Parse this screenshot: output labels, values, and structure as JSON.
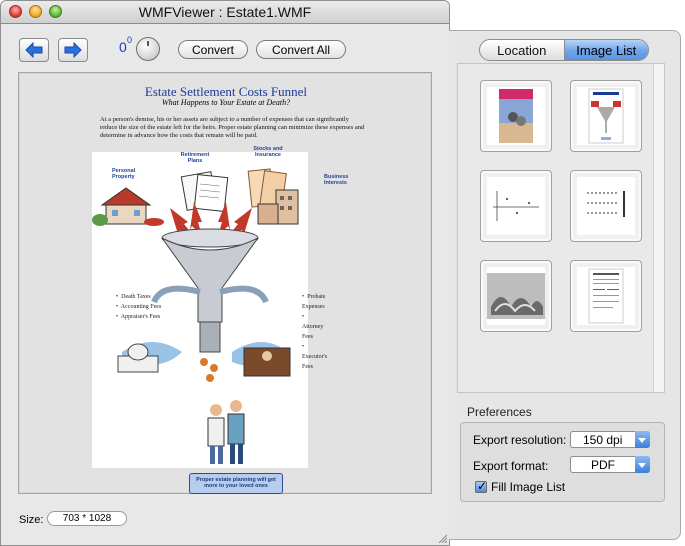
{
  "window": {
    "title": "WMFViewer : Estate1.WMF"
  },
  "toolbar": {
    "back_icon": "left-arrow-icon",
    "forward_icon": "right-arrow-icon",
    "rotation_value": "0",
    "rotation_superscript": "0",
    "convert_label": "Convert",
    "convert_all_label": "Convert All"
  },
  "document": {
    "title": "Estate Settlement Costs Funnel",
    "subtitle": "What Happens to Your Estate at Death?",
    "paragraph": "At a person's demise, his or her assets are subject to a number of expenses that can significantly reduce the size of the estate left for the heirs.  Proper estate planning can minimize these expenses and determine in advance how the costs that remain will be paid.",
    "labels": {
      "retirement": "Retirement Plans",
      "stocks": "Stocks and Insurance",
      "personal": "Personal Property",
      "business": "Business Interests"
    },
    "left_fees": [
      "Death Taxes",
      "Accounting Fees",
      "Appraiser's Fees"
    ],
    "right_fees": [
      "Probate Expenses",
      "Attorney Fees",
      "Executor's Fees"
    ],
    "caption": "Proper estate planning will get more to your loved ones"
  },
  "status": {
    "size_label": "Size:",
    "size_value": "703 * 1028"
  },
  "drawer": {
    "tabs": [
      {
        "label": "Location",
        "selected": false
      },
      {
        "label": "Image List",
        "selected": true
      }
    ],
    "preferences_title": "Preferences",
    "export_resolution_label": "Export resolution:",
    "export_resolution_value": "150 dpi",
    "export_format_label": "Export format:",
    "export_format_value": "PDF",
    "fill_image_list_label": "Fill Image List",
    "fill_image_list_checked": true
  },
  "colors": {
    "accent_blue": "#3b7fd9",
    "doc_title_blue": "#1c3a9b"
  }
}
